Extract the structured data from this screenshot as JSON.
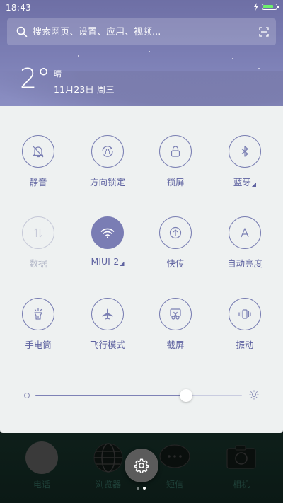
{
  "status_bar": {
    "time": "18:43",
    "battery_level": 0.8,
    "battery_color": "#6df06d"
  },
  "search": {
    "placeholder": "搜索网页、设置、应用、视频..."
  },
  "weather": {
    "temperature": "2°",
    "condition": "晴",
    "date": "11月23日 周三"
  },
  "toggles": [
    {
      "label": "静音",
      "icon": "mute-bell-icon",
      "state": "off"
    },
    {
      "label": "方向锁定",
      "icon": "rotation-lock-icon",
      "state": "off"
    },
    {
      "label": "锁屏",
      "icon": "lock-icon",
      "state": "off"
    },
    {
      "label": "蓝牙",
      "icon": "bluetooth-icon",
      "state": "off",
      "has_menu": true
    },
    {
      "label": "数据",
      "icon": "mobile-data-icon",
      "state": "disabled"
    },
    {
      "label": "MIUI-2",
      "icon": "wifi-icon",
      "state": "on",
      "has_menu": true
    },
    {
      "label": "快传",
      "icon": "quick-transfer-icon",
      "state": "off"
    },
    {
      "label": "自动亮度",
      "icon": "auto-brightness-icon",
      "state": "off"
    },
    {
      "label": "手电筒",
      "icon": "flashlight-icon",
      "state": "off"
    },
    {
      "label": "飞行模式",
      "icon": "airplane-icon",
      "state": "off"
    },
    {
      "label": "截屏",
      "icon": "screenshot-icon",
      "state": "off"
    },
    {
      "label": "振动",
      "icon": "vibrate-icon",
      "state": "off"
    }
  ],
  "brightness": {
    "level": 0.73
  },
  "dock": {
    "apps": [
      {
        "label": "电话",
        "icon": "phone-app-icon"
      },
      {
        "label": "浏览器",
        "icon": "browser-app-icon"
      },
      {
        "label": "短信",
        "icon": "messages-app-icon"
      },
      {
        "label": "相机",
        "icon": "camera-app-icon"
      }
    ],
    "page_count": 2,
    "current_page": 2
  },
  "colors": {
    "accent": "#7a7db4",
    "panel_bg": "#eef1f1",
    "label": "#5e62a0"
  }
}
